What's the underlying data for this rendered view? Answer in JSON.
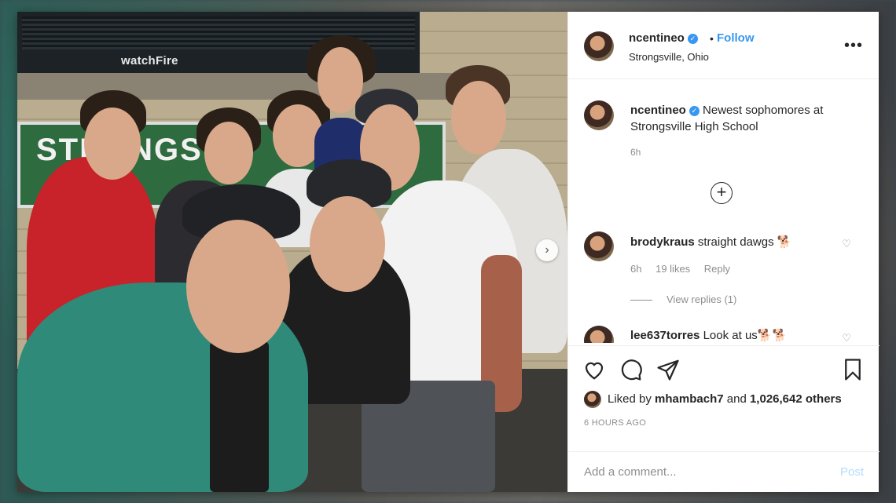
{
  "post": {
    "username": "ncentineo",
    "follow_label": "Follow",
    "dot": "•",
    "location": "Strongsville, Ohio",
    "more": "•••"
  },
  "photo": {
    "brand_text": "watchFire",
    "sign_text": "STRONGSV",
    "next_arrow": "›"
  },
  "caption": {
    "username": "ncentineo",
    "text": "Newest sophomores at Strongsville High School",
    "time": "6h"
  },
  "comments": [
    {
      "username": "brodykraus",
      "text": "straight dawgs 🐕",
      "time": "6h",
      "likes": "19 likes",
      "reply": "Reply"
    },
    {
      "username": "lee637torres",
      "text": "Look at us🐕🐕"
    }
  ],
  "view_replies": "View replies (1)",
  "likes": {
    "prefix": "Liked by",
    "user": "mhambach7",
    "middle": "and",
    "count": "1,026,642 others"
  },
  "time_ago": "6 HOURS AGO",
  "add_comment": {
    "placeholder": "Add a comment...",
    "post_label": "Post"
  },
  "icons": [
    "heart-icon",
    "comment-icon",
    "share-icon",
    "bookmark-icon",
    "plus-circle-icon",
    "more-icon",
    "verified-icon"
  ],
  "colors": {
    "link": "#3897f0",
    "post_disabled": "#b3dbff",
    "muted": "#8e8e8e",
    "text": "#262626"
  }
}
